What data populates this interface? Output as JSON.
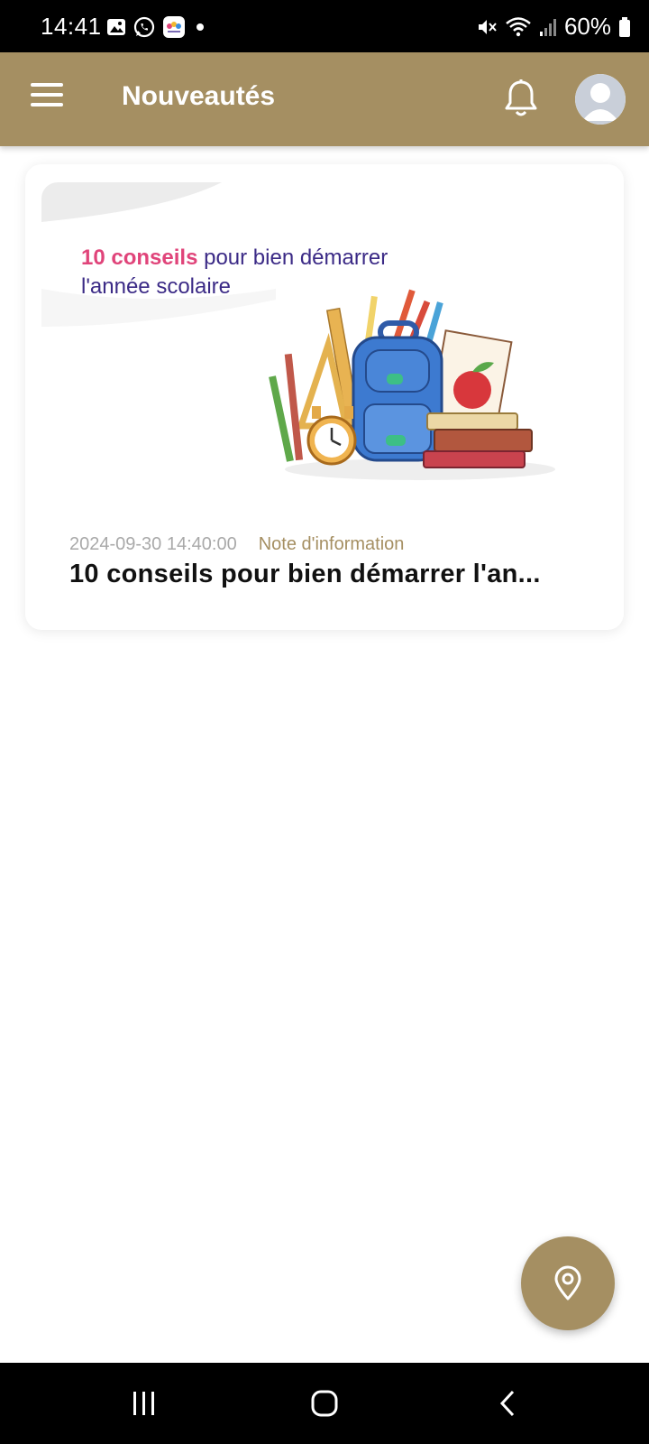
{
  "status_bar": {
    "time": "14:41",
    "battery": "60%",
    "icons": [
      "gallery-icon",
      "whatsapp-icon",
      "app-icon",
      "dot-icon",
      "mute-icon",
      "wifi-icon",
      "signal-icon",
      "battery-icon"
    ]
  },
  "app_bar": {
    "title": "Nouveautés",
    "background_color": "#a58f62",
    "icons": [
      "menu-icon",
      "bell-icon",
      "avatar-icon"
    ]
  },
  "news": [
    {
      "image_heading_highlight": "10 conseils",
      "image_heading_rest": " pour bien démarrer",
      "image_heading_line2": "l'année scolaire",
      "date": "2024-09-30 14:40:00",
      "category": "Note d'information",
      "title": "10 conseils pour bien démarrer l'an..."
    }
  ],
  "fab": {
    "icon": "location-pin-icon"
  },
  "nav_bar": {
    "icons": [
      "recent-apps-icon",
      "home-icon",
      "back-icon"
    ]
  }
}
